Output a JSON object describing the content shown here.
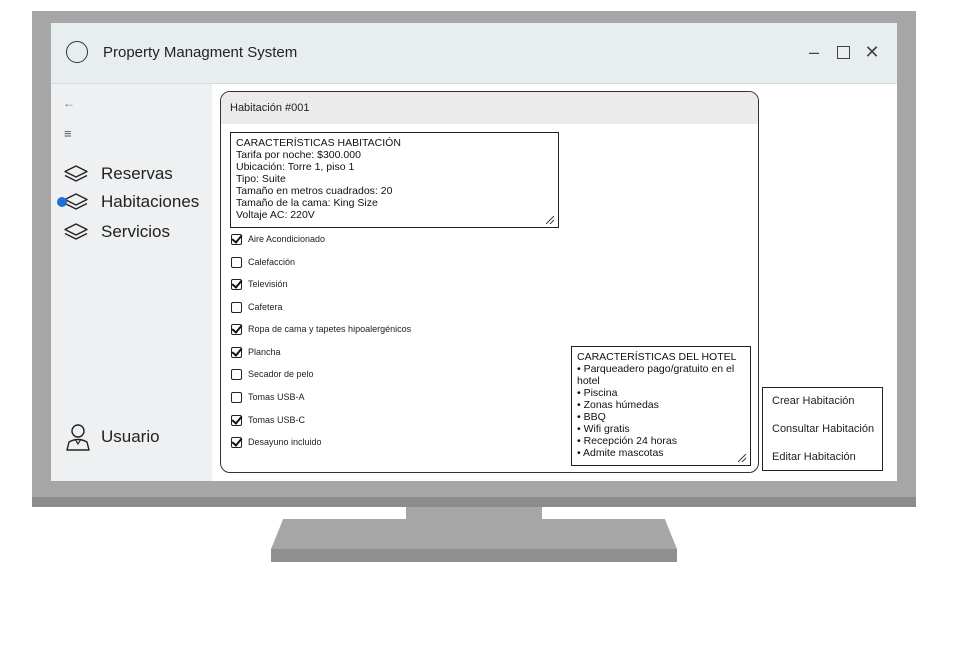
{
  "window": {
    "title": "Property Managment System"
  },
  "sidebar": {
    "back_label": "←",
    "menu_label": "≡",
    "items": [
      {
        "label": "Reservas",
        "icon": "layers-icon",
        "active": false
      },
      {
        "label": "Habitaciones",
        "icon": "layers-icon",
        "active": true
      },
      {
        "label": "Servicios",
        "icon": "layers-icon",
        "active": false
      }
    ],
    "user": {
      "label": "Usuario",
      "icon": "user-icon"
    }
  },
  "panel": {
    "title": "Habitación #001",
    "room_characteristics": [
      "CARACTERÍSTICAS HABITACIÓN",
      "Tarifa por noche: $300.000",
      "Ubicación: Torre 1, piso 1",
      "Tipo: Suite",
      "Tamaño en metros cuadrados: 20",
      "Tamaño de la cama: King Size",
      "Voltaje AC: 220V"
    ],
    "amenities": [
      {
        "label": "Aire Acondicionado",
        "checked": true
      },
      {
        "label": "Calefacción",
        "checked": false
      },
      {
        "label": "Televisión",
        "checked": true
      },
      {
        "label": "Cafetera",
        "checked": false
      },
      {
        "label": "Ropa de cama y tapetes hipoalergénicos",
        "checked": true
      },
      {
        "label": "Plancha",
        "checked": true
      },
      {
        "label": "Secador de pelo",
        "checked": false
      },
      {
        "label": "Tomas USB-A",
        "checked": false
      },
      {
        "label": "Tomas USB-C",
        "checked": true
      },
      {
        "label": "Desayuno incluido",
        "checked": true
      }
    ],
    "hotel_characteristics": [
      "CARACTERÍSTICAS DEL HOTEL",
      "• Parqueadero pago/gratuito en el hotel",
      "• Piscina",
      "• Zonas húmedas",
      "• BBQ",
      "• Wifi gratis",
      "• Recepción 24 horas",
      "• Admite mascotas"
    ]
  },
  "actions": {
    "create": "Crear Habitación",
    "consult": "Consultar Habitación",
    "edit": "Editar Habitación"
  },
  "colors": {
    "active_dot": "#1e6fd9",
    "titlebar": "#e8eef0",
    "sidebar": "#eef0f2",
    "monitor": "#a6a6a6"
  }
}
